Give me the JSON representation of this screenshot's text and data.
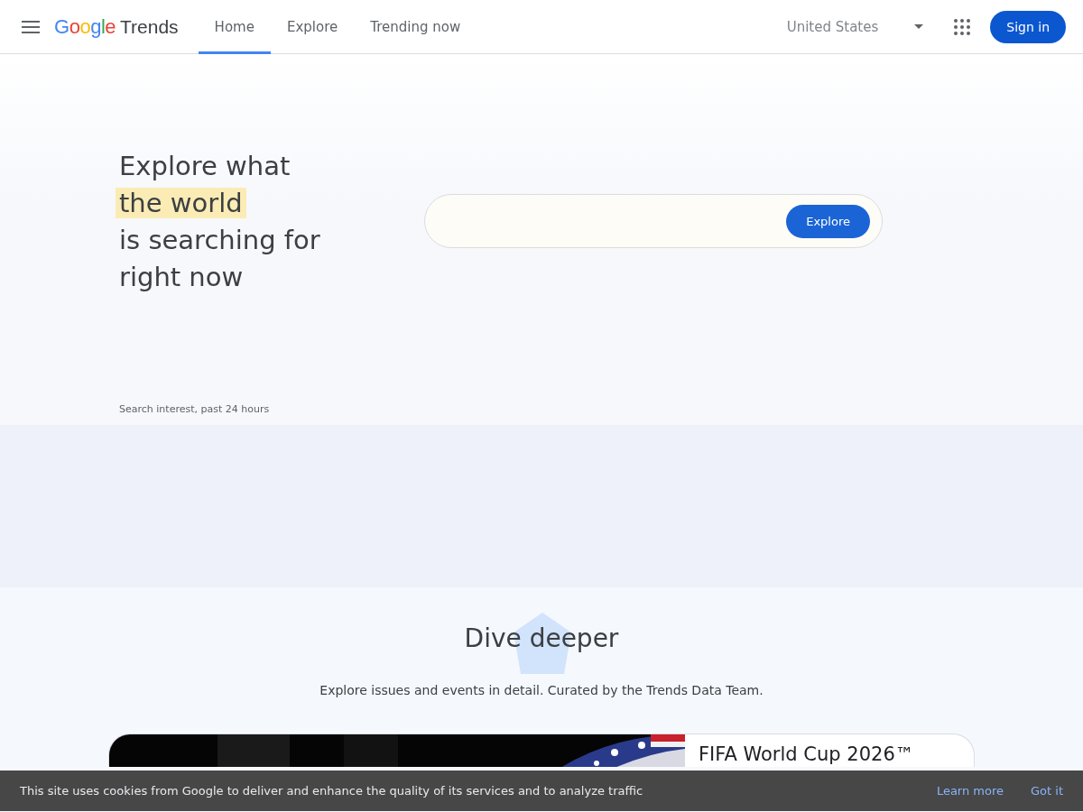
{
  "header": {
    "logo": {
      "brand": "Google",
      "product": "Trends"
    },
    "tabs": [
      {
        "label": "Home",
        "selected": true
      },
      {
        "label": "Explore",
        "selected": false
      },
      {
        "label": "Trending now",
        "selected": false
      }
    ],
    "region": "United States",
    "sign_in": "Sign in"
  },
  "hero": {
    "heading": [
      {
        "text": "Explore what",
        "highlighted": false
      },
      {
        "text": "the world",
        "highlighted": true
      },
      {
        "text": "is searching for",
        "highlighted": false
      },
      {
        "text": "right now",
        "highlighted": false
      }
    ],
    "search_button": "Explore",
    "caption": "Search interest, past 24 hours"
  },
  "dive_deeper": {
    "title": "Dive deeper",
    "subtitle": "Explore issues and events in detail. Curated by the Trends Data Team.",
    "card": {
      "kind": "picture",
      "title": "FIFA World Cup 2026™"
    }
  },
  "cookie_bar": {
    "text": "This site uses cookies from Google to deliver and enhance the quality of its services and to analyze traffic",
    "learn_more": "Learn more",
    "got_it": "Got it"
  }
}
